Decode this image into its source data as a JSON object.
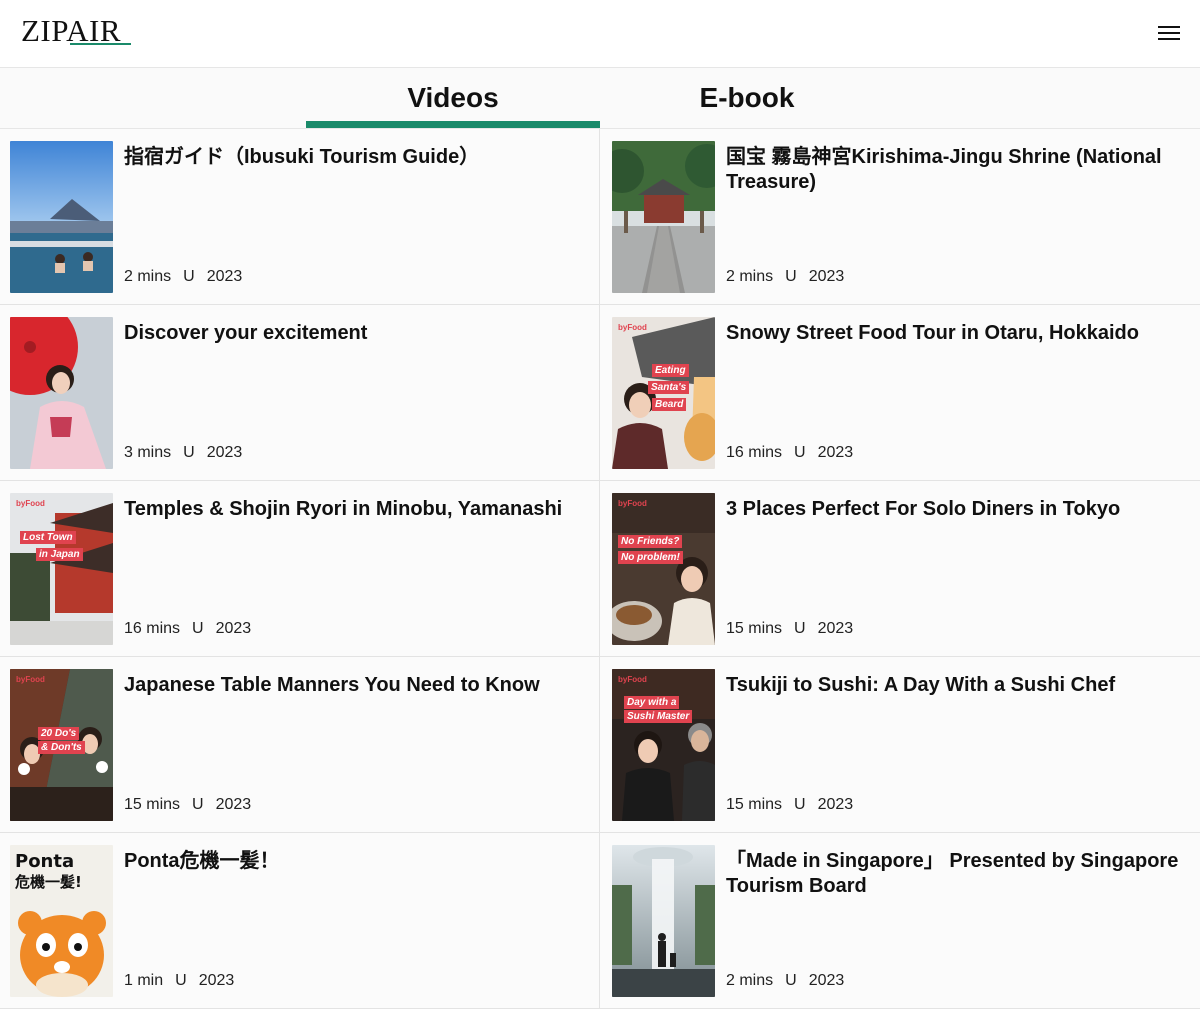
{
  "header": {
    "logo": "ZIPAIR",
    "menu_icon": "hamburger-menu-icon"
  },
  "tabs": [
    {
      "label": "Videos",
      "active": true
    },
    {
      "label": "E-book",
      "active": false
    }
  ],
  "accent_color": "#1a8a6a",
  "videos": [
    {
      "title": "指宿ガイド（Ibusuki Tourism Guide）",
      "duration": "2 mins",
      "rating": "U",
      "year": "2023"
    },
    {
      "title": "国宝 霧島神宮Kirishima-Jingu Shrine (National Treasure)",
      "duration": "2 mins",
      "rating": "U",
      "year": "2023"
    },
    {
      "title": "Discover your excitement",
      "duration": "3 mins",
      "rating": "U",
      "year": "2023"
    },
    {
      "title": "Snowy Street Food Tour in Otaru, Hokkaido",
      "duration": "16 mins",
      "rating": "U",
      "year": "2023",
      "thumb_text": [
        "byFood",
        "Eating",
        "Santa's",
        "Beard"
      ]
    },
    {
      "title": "Temples & Shojin Ryori in Minobu, Yamanashi",
      "duration": "16 mins",
      "rating": "U",
      "year": "2023",
      "thumb_text": [
        "byFood",
        "Lost Town",
        "in Japan"
      ]
    },
    {
      "title": "3 Places Perfect For Solo Diners in Tokyo",
      "duration": "15 mins",
      "rating": "U",
      "year": "2023",
      "thumb_text": [
        "byFood",
        "No Friends?",
        "No problem!"
      ]
    },
    {
      "title": "Japanese Table Manners You Need to Know",
      "duration": "15 mins",
      "rating": "U",
      "year": "2023",
      "thumb_text": [
        "byFood",
        "20 Do's",
        "& Don'ts"
      ]
    },
    {
      "title": "Tsukiji to Sushi: A Day With a Sushi Chef",
      "duration": "15 mins",
      "rating": "U",
      "year": "2023",
      "thumb_text": [
        "byFood",
        "Day with a",
        "Sushi Master"
      ]
    },
    {
      "title": "Ponta危機一髪！",
      "duration": "1 min",
      "rating": "U",
      "year": "2023",
      "thumb_text": [
        "Ponta",
        "危機一髪!"
      ]
    },
    {
      "title": "「Made in Singapore」 Presented by Singapore Tourism Board",
      "duration": "2 mins",
      "rating": "U",
      "year": "2023"
    }
  ]
}
